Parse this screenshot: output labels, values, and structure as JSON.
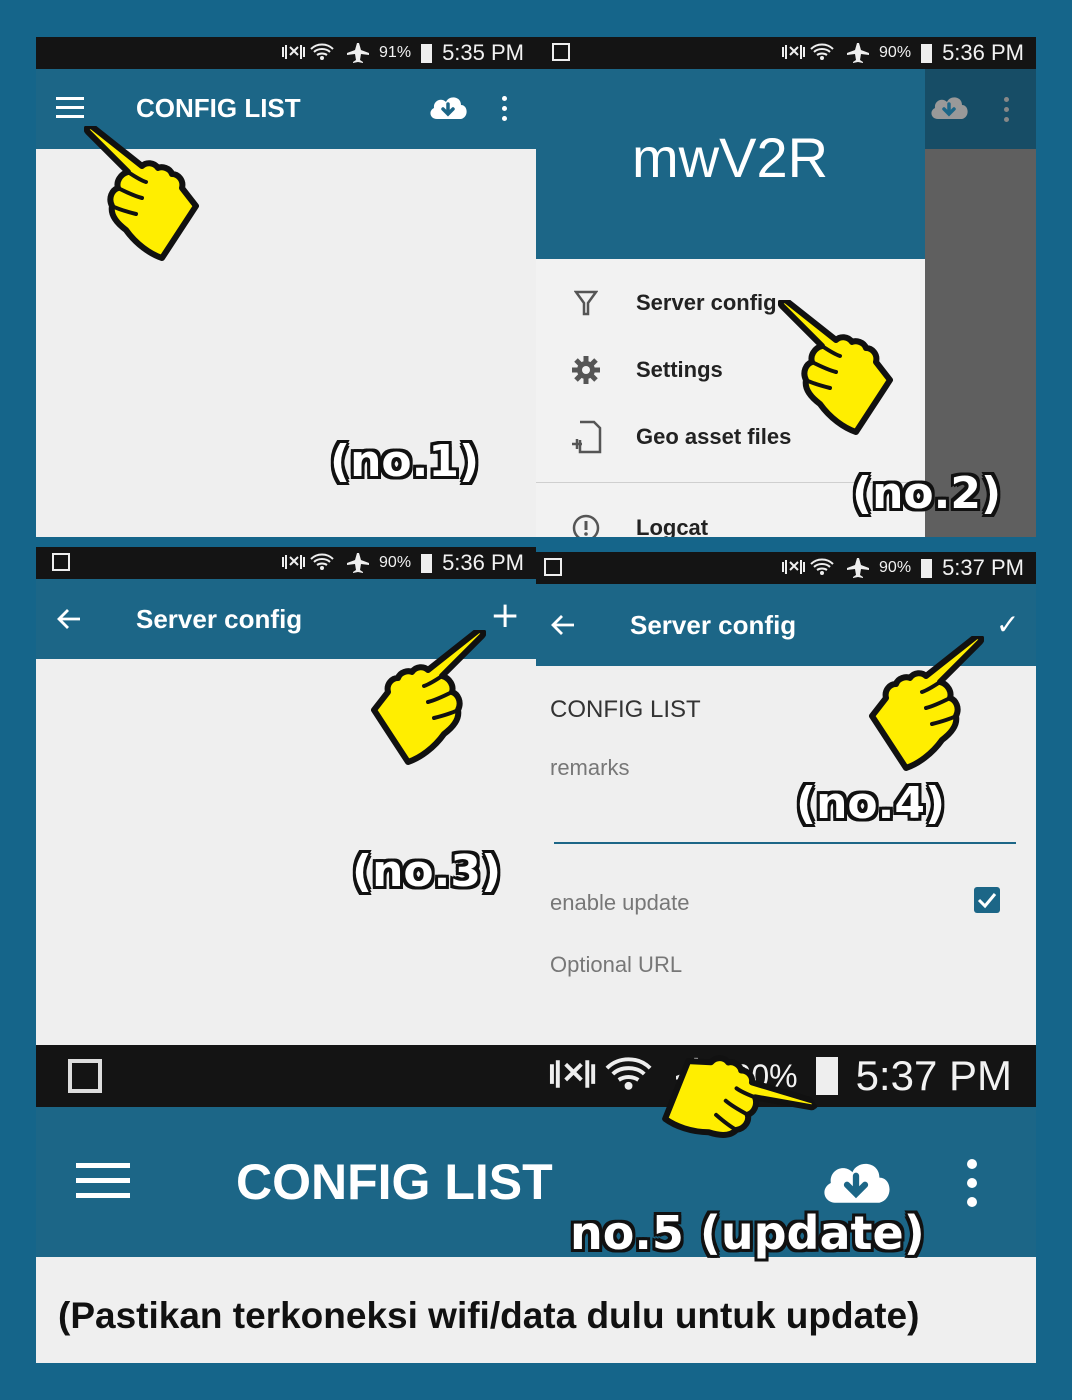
{
  "panel1": {
    "status": {
      "battery": "91%",
      "time": "5:35 PM"
    },
    "toolbar": {
      "title": "CONFIG LIST"
    },
    "annotation": "(no.1)",
    "icons": [
      "menu-icon",
      "cloud-download-icon",
      "more-vert-icon"
    ]
  },
  "panel2": {
    "status": {
      "battery": "90%",
      "time": "5:36 PM"
    },
    "drawer": {
      "app_name": "mwV2R",
      "items": [
        {
          "label": "Server config",
          "icon": "filter-icon"
        },
        {
          "label": "Settings",
          "icon": "gear-icon"
        },
        {
          "label": "Geo asset files",
          "icon": "file-add-icon"
        },
        {
          "label": "Logcat",
          "icon": "info-icon"
        }
      ]
    },
    "annotation": "(no.2)"
  },
  "panel3": {
    "status": {
      "battery": "90%",
      "time": "5:36 PM"
    },
    "toolbar": {
      "title": "Server config",
      "add": "+"
    },
    "annotation": "(no.3)"
  },
  "panel4": {
    "status": {
      "battery": "90%",
      "time": "5:37 PM"
    },
    "toolbar": {
      "title": "Server config",
      "confirm": "✓"
    },
    "form": {
      "value": "CONFIG LIST",
      "remarks_label": "remarks",
      "enable_update_label": "enable update",
      "enable_update_checked": true,
      "optional_url_label": "Optional URL"
    },
    "annotation": "(no.4)"
  },
  "panel5": {
    "status": {
      "battery": "90%",
      "time": "5:37 PM"
    },
    "toolbar": {
      "title": "CONFIG LIST"
    },
    "annotation": "no.5 (update)",
    "note": "(Pastikan terkoneksi wifi/data dulu untuk update)"
  },
  "colors": {
    "background": "#15658a",
    "toolbar": "#1c6687",
    "statusbar": "#141414",
    "content": "#efefef",
    "pointer_hand": "#ffee00",
    "checkbox": "#1c6687"
  }
}
